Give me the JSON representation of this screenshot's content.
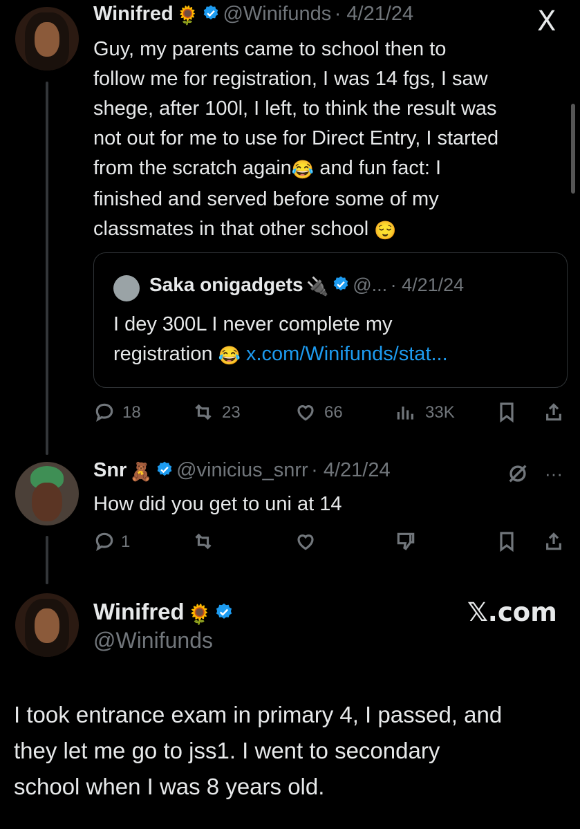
{
  "tweet1": {
    "name": "Winifred",
    "name_emoji": "🌻",
    "handle": "@Winifunds",
    "date": "· 4/21/24",
    "body_lines": [
      "Guy, my parents came to school then to",
      "follow me for registration, I was 14 fgs, I saw",
      "shege, after 100l, I left, to think the result was",
      "not out for me to use for Direct Entry, I started",
      "from the scratch again",
      " and fun fact: I",
      "finished and served before some of my",
      "classmates in that other school "
    ],
    "emoji_laugh": "😂",
    "emoji_relieved": "😌",
    "quote": {
      "name": "Saka onigadgets",
      "name_emoji": "🔌",
      "handle": "@...",
      "date": "· 4/21/24",
      "line1": "I dey 300L I never complete my",
      "line2": "registration",
      "emoji": "😂",
      "link": "x.com/Winifunds/stat..."
    },
    "actions": {
      "replies": "18",
      "reposts": "23",
      "likes": "66",
      "views": "33K"
    }
  },
  "tweet2": {
    "name": "Snr",
    "name_emoji": "🧸",
    "handle": "@vinicius_snrr",
    "date": "· 4/21/24",
    "body": "How did you get to uni at 14",
    "actions": {
      "replies": "1"
    },
    "more": "···"
  },
  "tweet3": {
    "name": "Winifred",
    "name_emoji": "🌻",
    "handle": "@Winifunds",
    "brand": "𝕏.com",
    "body_lines": [
      "I took entrance exam in primary 4, I passed, and",
      "they let me go to jss1. I went to secondary",
      "school when I was 8 years old."
    ]
  },
  "top_brand": "X",
  "colors": {
    "background": "#000000",
    "text": "#e7e9ea",
    "muted": "#71767b",
    "link": "#1d9bf0",
    "verified": "#1d9bf0"
  },
  "icons": [
    "reply-icon",
    "repost-icon",
    "like-icon",
    "views-icon",
    "bookmark-icon",
    "share-icon",
    "verified-icon",
    "x-logo-icon",
    "grok-icon",
    "downvote-icon",
    "more-icon"
  ]
}
